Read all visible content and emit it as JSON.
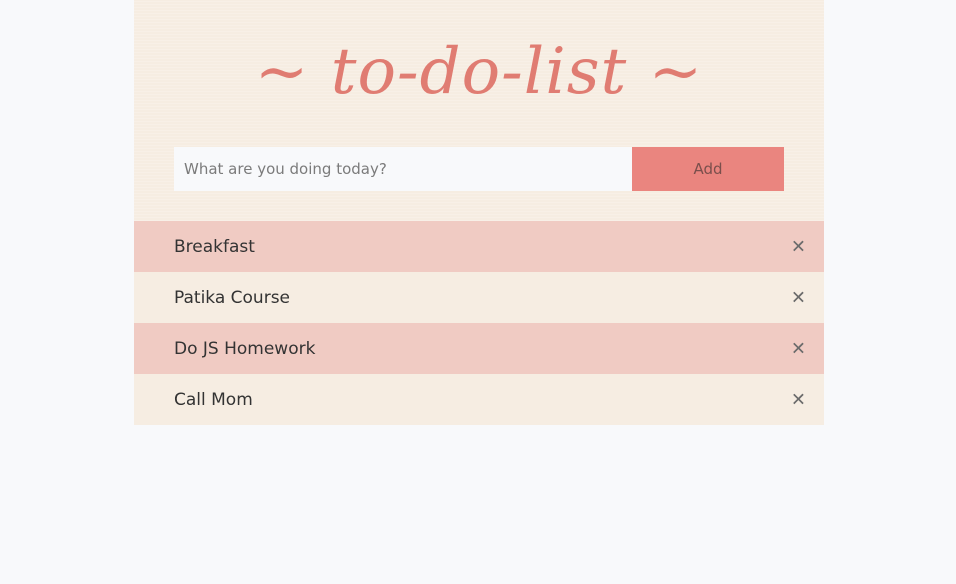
{
  "header": {
    "title": "~ to-do-list ~"
  },
  "form": {
    "placeholder": "What are you doing today?",
    "value": "",
    "add_label": "Add"
  },
  "tasks": [
    {
      "label": "Breakfast",
      "close": "✕"
    },
    {
      "label": "Patika Course",
      "close": "✕"
    },
    {
      "label": "Do JS Homework",
      "close": "✕"
    },
    {
      "label": "Call Mom",
      "close": "✕"
    }
  ],
  "colors": {
    "accent": "#ea857f",
    "title": "#e07c72",
    "panel": "#f6ede2",
    "row_alt": "#f0cbc3",
    "page": "#f8f9fb"
  }
}
